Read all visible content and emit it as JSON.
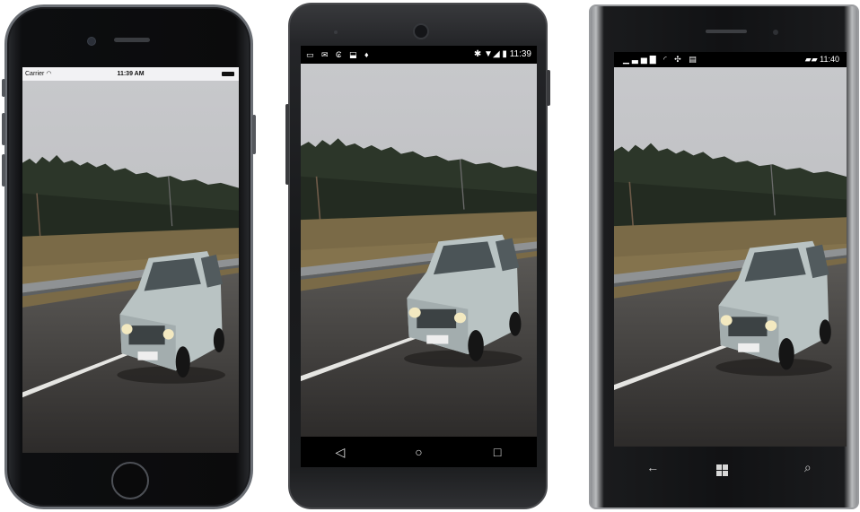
{
  "iphone": {
    "status": {
      "carrier": "Carrier",
      "wifi_icon": "wifi-icon",
      "time": "11:39 AM",
      "battery_icon": "battery-icon"
    },
    "home_button_icon": "circle-icon"
  },
  "android": {
    "status": {
      "left_icons": "▭ ✉ ₢ ⬓ ♦",
      "right_icons": "✱ ▼◢ ▮",
      "time": "11:39"
    },
    "navbar": {
      "back": "◁",
      "home": "○",
      "recents": "□"
    }
  },
  "winphone": {
    "status": {
      "left_icons": "▁▃▅▇ ◜ ✣ ▤",
      "right_icons": "▰▰",
      "time": "11:40"
    },
    "navbar": {
      "back": "←",
      "search": "⌕"
    }
  },
  "colors": {
    "sky": "#c8c9cb",
    "forest": "#2f3a2c",
    "grass": "#7b6b47",
    "road": "#4a4847",
    "car": "#b8c2c2"
  }
}
